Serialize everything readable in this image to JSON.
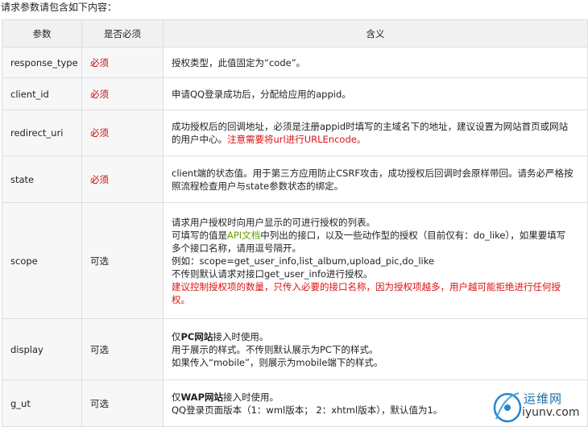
{
  "intro_text": "请求参数请包含如下内容：",
  "table": {
    "headers": [
      "参数",
      "是否必须",
      "含义"
    ],
    "rows": [
      {
        "param": "response_type",
        "required": "必须",
        "desc_lines": [
          [
            "授权类型，此值固定为“code”。"
          ]
        ]
      },
      {
        "param": "client_id",
        "required": "必须",
        "desc_lines": [
          [
            "申请QQ登录成功后，分配给应用的appid。"
          ]
        ]
      },
      {
        "param": "redirect_uri",
        "required": "必须",
        "desc_lines": [
          [
            "成功授权后的回调地址，必须是注册appid时填写的主域名下的地址，建议设置为网站首页或网站"
          ],
          [
            "的用户中心。",
            "注意需要将url进行URLEncode。"
          ]
        ]
      },
      {
        "param": "state",
        "required": "必须",
        "desc_lines": [
          [
            "client端的状态值。用于第三方应用防止CSRF攻击，成功授权后回调时会原样带回。请务必严格按"
          ],
          [
            "照流程检查用户与state参数状态的绑定。"
          ]
        ]
      },
      {
        "param": "scope",
        "required": "可选",
        "desc_lines": [
          [
            "请求用户授权时向用户显示的可进行授权的列表。"
          ],
          [
            "可填写的值是",
            "API文档",
            "中列出的接口，以及一些动作型的授权（目前仅有：do_like），如果要填写"
          ],
          [
            "多个接口名称，请用逗号隔开。"
          ],
          [
            "例如：scope=get_user_info,list_album,upload_pic,do_like"
          ],
          [
            "不传则默认请求对接口get_user_info进行授权。"
          ],
          [
            "建议控制授权项的数量，只传入必要的接口名称，因为授权项越多，用户越可能拒绝进行任何授"
          ],
          [
            "权。"
          ]
        ]
      },
      {
        "param": "display",
        "required": "可选",
        "desc_lines": [
          [
            "仅",
            "PC网站",
            "接入时使用。"
          ],
          [
            "用于展示的样式。不传则默认展示为PC下的样式。"
          ],
          [
            "如果传入“mobile”，则展示为mobile端下的样式。"
          ]
        ]
      },
      {
        "param": "g_ut",
        "required": "可选",
        "desc_lines": [
          [
            "仅",
            "WAP网站",
            "接入时使用。"
          ],
          [
            "QQ登录页面版本（1：wml版本； 2：xhtml版本），默认值为1。"
          ]
        ]
      }
    ]
  },
  "watermark": {
    "cn": "运维网",
    "en": "iyunv.com"
  },
  "colors": {
    "required_red": "#cc0000",
    "note_red": "#dd1111",
    "link_green": "#66a000",
    "header_bg": "#f1f1f1",
    "border": "#dedede"
  },
  "icons": [
    "watermark-logo-icon"
  ]
}
